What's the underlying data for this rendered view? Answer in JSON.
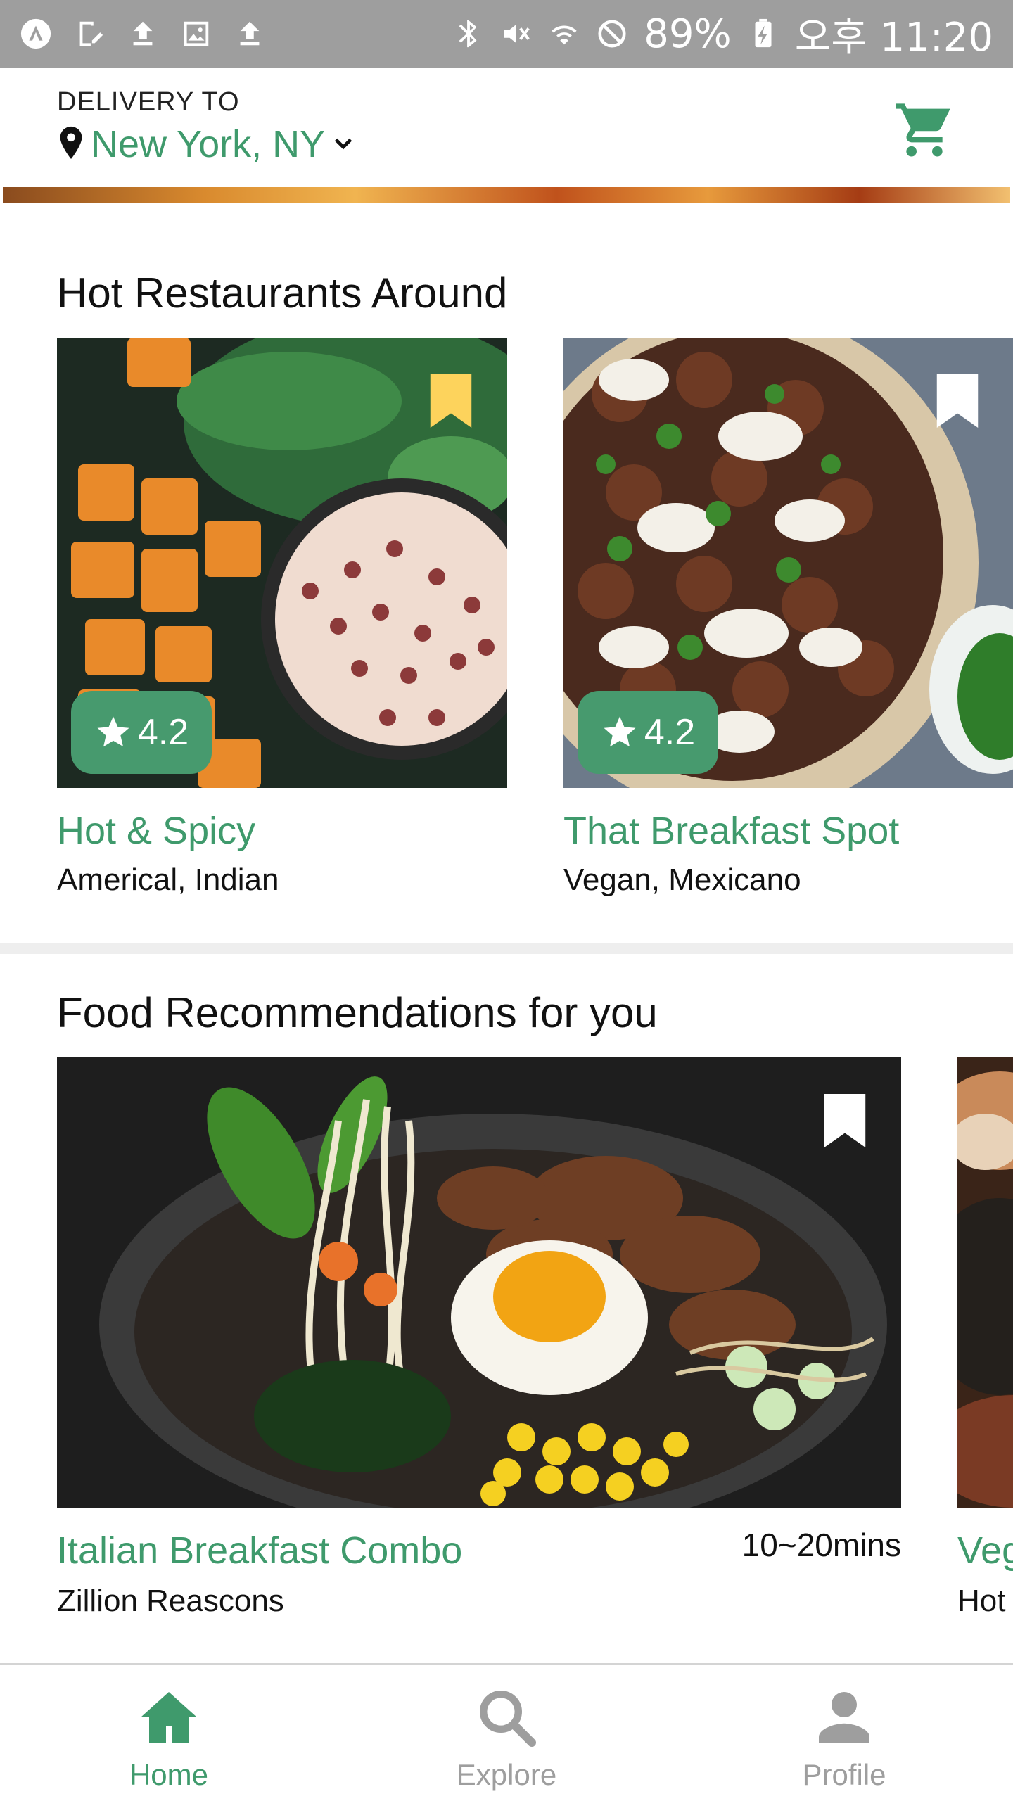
{
  "status_bar": {
    "battery": "89%",
    "time": "오후 11:20",
    "left_icons": [
      "app-icon",
      "edit-icon",
      "upload-icon",
      "image-icon",
      "upload-icon"
    ],
    "right_icons": [
      "bluetooth-icon",
      "mute-icon",
      "wifi-icon",
      "do-not-disturb-icon",
      "battery-charging-icon"
    ]
  },
  "header": {
    "delivery_label": "DELIVERY TO",
    "location": "New York, NY"
  },
  "hot_restaurants": {
    "title": "Hot Restaurants Around",
    "items": [
      {
        "name": "Hot & Spicy",
        "cuisine": "Americal, Indian",
        "rating": "4.2",
        "bookmarked": true
      },
      {
        "name": "That Breakfast Spot",
        "cuisine": "Vegan, Mexicano",
        "rating": "4.2",
        "bookmarked": false
      }
    ]
  },
  "food_recommendations": {
    "title": "Food Recommendations for you",
    "items": [
      {
        "name": "Italian Breakfast Combo",
        "shop": "Zillion Reascons",
        "time": "10~20mins"
      },
      {
        "name": "Veg",
        "shop": "Hot"
      }
    ]
  },
  "bottom_nav": {
    "items": [
      {
        "label": "Home",
        "icon": "home-icon",
        "active": true
      },
      {
        "label": "Explore",
        "icon": "search-icon",
        "active": false
      },
      {
        "label": "Profile",
        "icon": "person-icon",
        "active": false
      }
    ]
  },
  "colors": {
    "accent": "#3f9a6c",
    "rating_bg": "#479a6e",
    "bookmark_active": "#fdd35c",
    "status_bar": "#9e9e9e",
    "inactive": "#9e9e9e"
  }
}
